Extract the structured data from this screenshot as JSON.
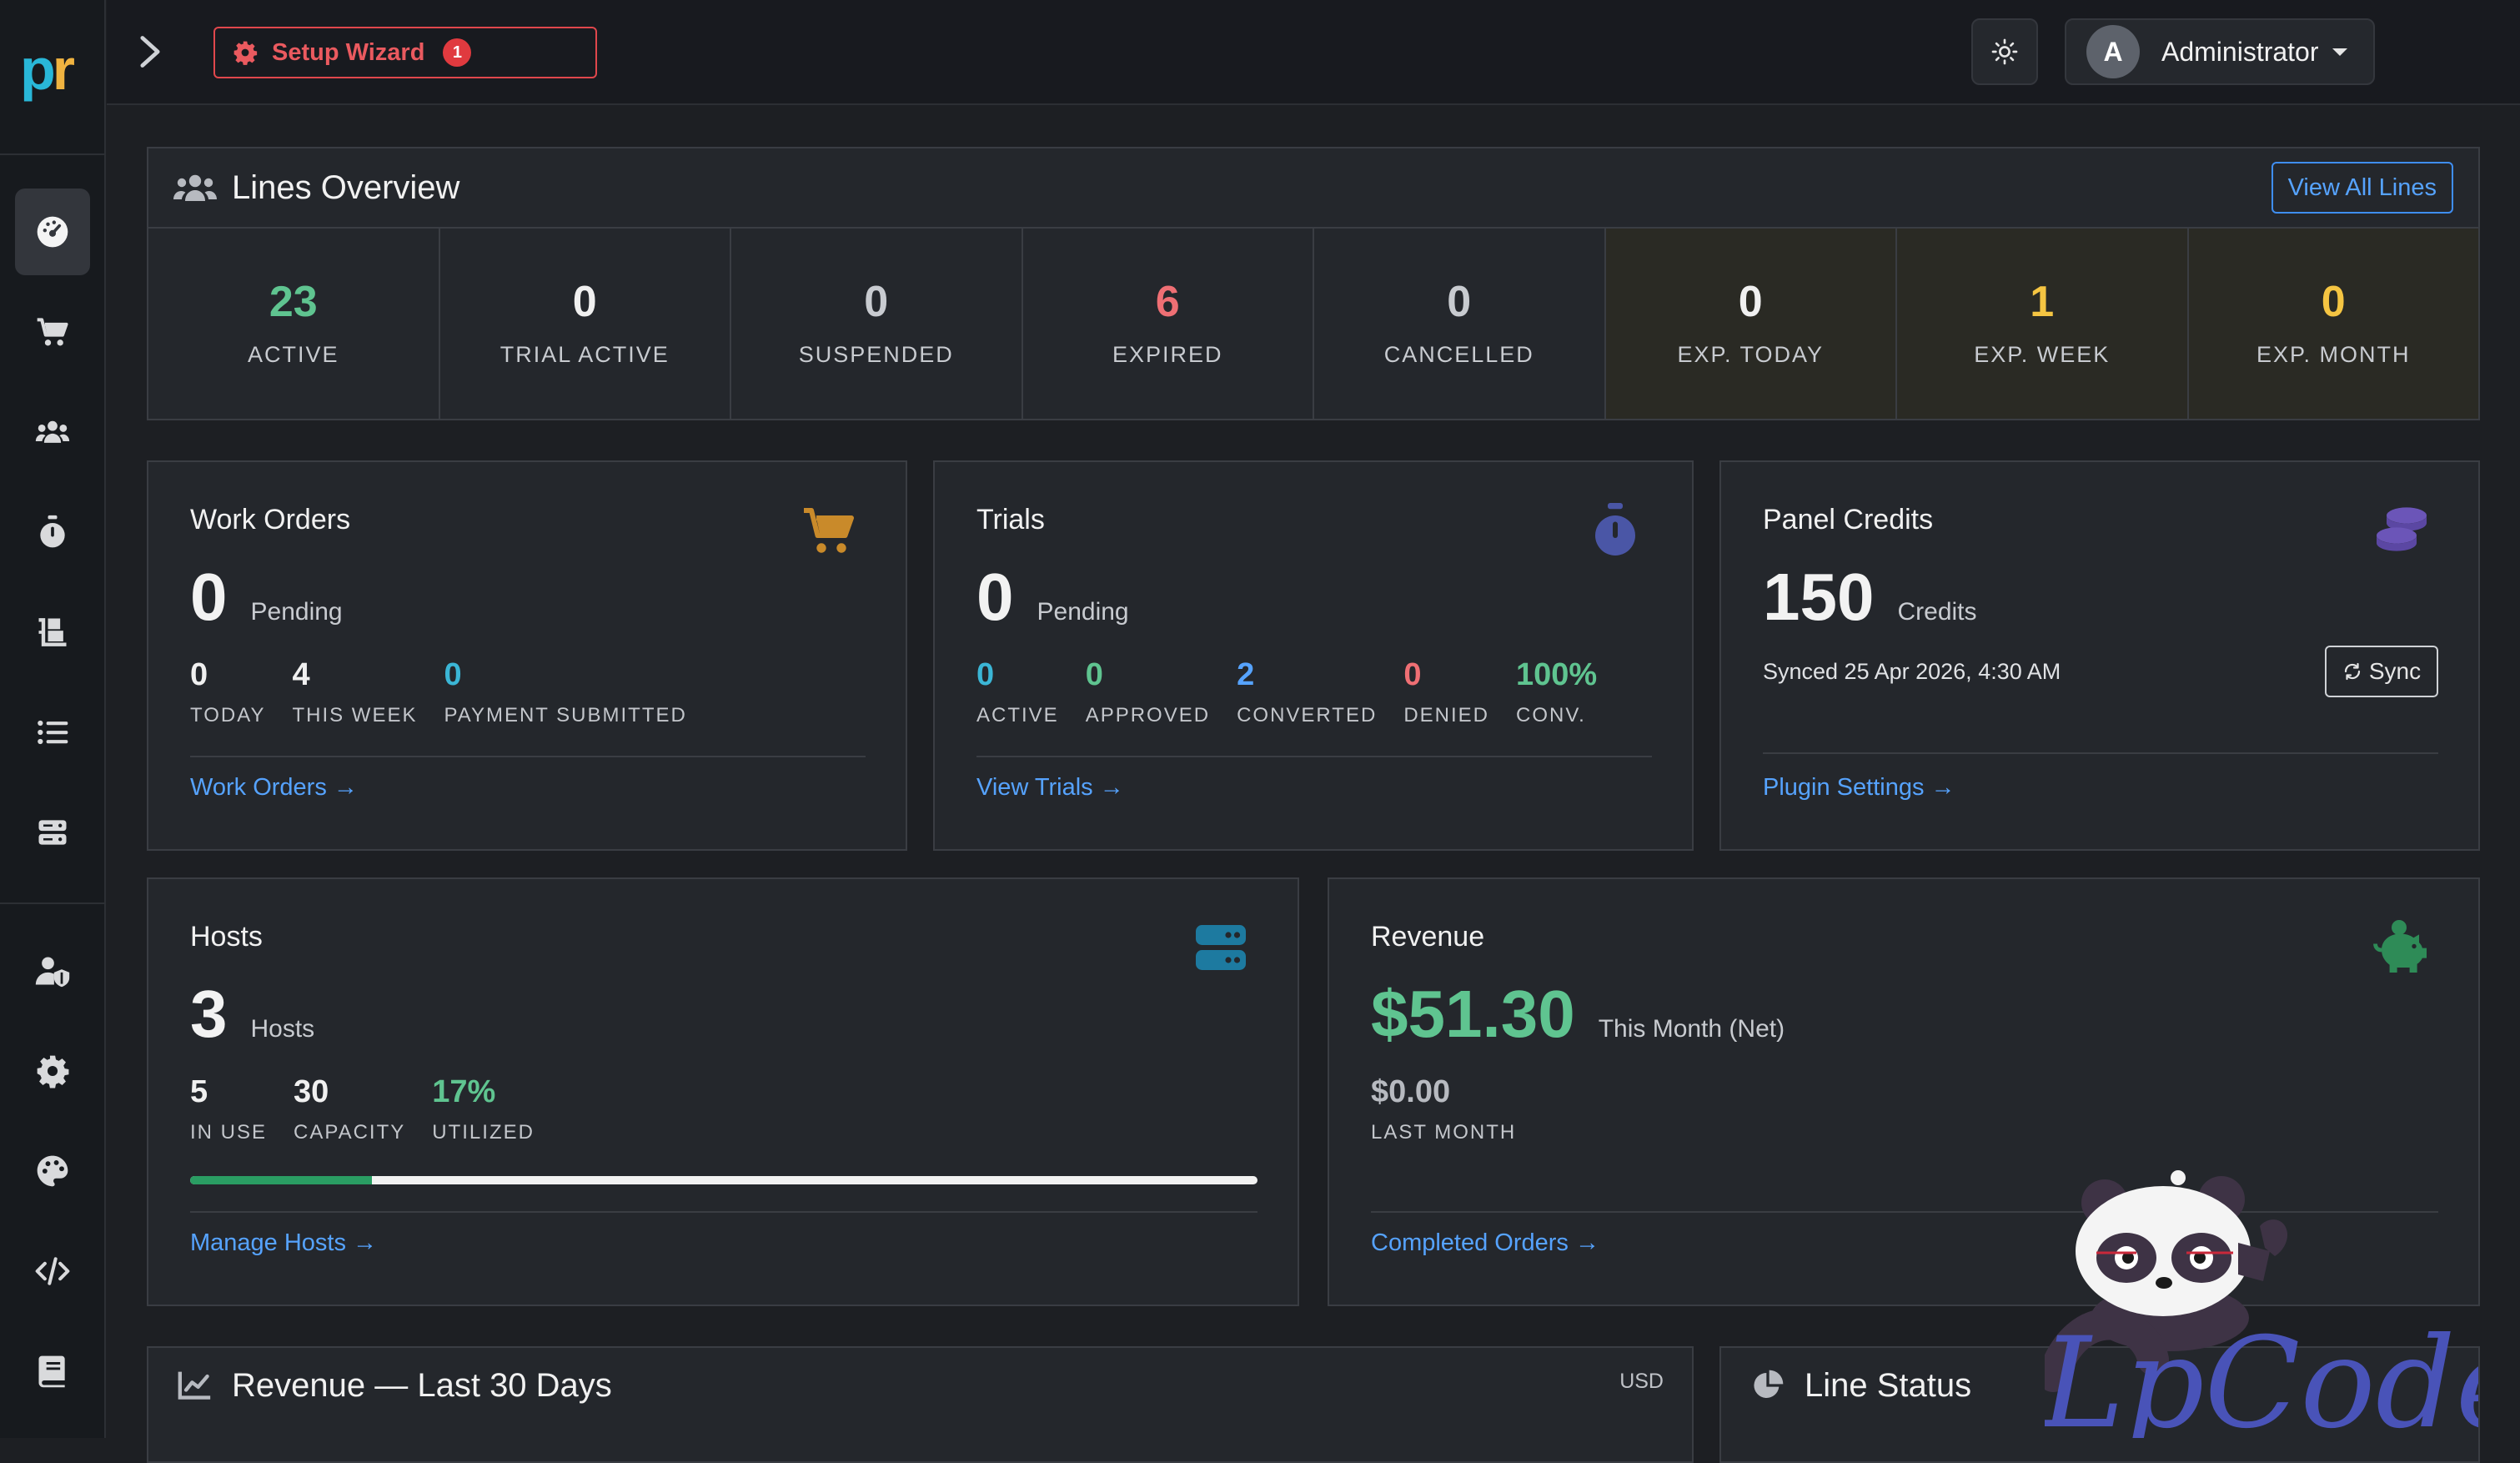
{
  "app": {
    "logo_left": "p",
    "logo_right": "r"
  },
  "sidebar": {
    "items": [
      {
        "icon": "dashboard-icon",
        "active": true
      },
      {
        "icon": "cart-icon"
      },
      {
        "icon": "users-icon"
      },
      {
        "icon": "stopwatch-icon"
      },
      {
        "icon": "dolly-icon"
      },
      {
        "icon": "list-icon"
      },
      {
        "icon": "server-icon"
      },
      {
        "icon": "user-shield-icon"
      },
      {
        "icon": "gear-icon"
      },
      {
        "icon": "palette-icon"
      },
      {
        "icon": "code-icon"
      },
      {
        "icon": "book-icon"
      }
    ]
  },
  "header": {
    "wizard_label": "Setup Wizard",
    "wizard_count": "1",
    "user_initial": "A",
    "user_name": "Administrator"
  },
  "lines_overview": {
    "title": "Lines Overview",
    "view_all": "View All Lines",
    "stats": [
      {
        "value": "23",
        "label": "ACTIVE",
        "color": "#5fc490"
      },
      {
        "value": "0",
        "label": "TRIAL ACTIVE",
        "color": "#f0f0f0"
      },
      {
        "value": "0",
        "label": "SUSPENDED",
        "color": "#c8cbd0"
      },
      {
        "value": "6",
        "label": "EXPIRED",
        "color": "#ef6f74"
      },
      {
        "value": "0",
        "label": "CANCELLED",
        "color": "#c8cbd0"
      },
      {
        "value": "0",
        "label": "EXP. TODAY",
        "color": "#f0f0f0"
      },
      {
        "value": "1",
        "label": "EXP. WEEK",
        "color": "#f5c542"
      },
      {
        "value": "0",
        "label": "EXP. MONTH",
        "color": "#f5c542"
      }
    ]
  },
  "work_orders": {
    "title": "Work Orders",
    "value": "0",
    "unit": "Pending",
    "subs": [
      {
        "value": "0",
        "label": "TODAY"
      },
      {
        "value": "4",
        "label": "THIS WEEK"
      },
      {
        "value": "0",
        "label": "PAYMENT SUBMITTED"
      }
    ],
    "link": "Work Orders →"
  },
  "trials": {
    "title": "Trials",
    "value": "0",
    "unit": "Pending",
    "subs": [
      {
        "value": "0",
        "label": "ACTIVE"
      },
      {
        "value": "0",
        "label": "APPROVED"
      },
      {
        "value": "2",
        "label": "CONVERTED"
      },
      {
        "value": "0",
        "label": "DENIED"
      },
      {
        "value": "100%",
        "label": "CONV."
      }
    ],
    "link": "View Trials →"
  },
  "panel_credits": {
    "title": "Panel Credits",
    "value": "150",
    "unit": "Credits",
    "synced": "Synced 25 Apr 2026, 4:30 AM",
    "sync_label": "Sync",
    "link": "Plugin Settings →"
  },
  "hosts": {
    "title": "Hosts",
    "value": "3",
    "unit": "Hosts",
    "subs": [
      {
        "value": "5",
        "label": "IN USE"
      },
      {
        "value": "30",
        "label": "CAPACITY"
      },
      {
        "value": "17%",
        "label": "UTILIZED"
      }
    ],
    "utilization": 0.17,
    "link": "Manage Hosts →"
  },
  "revenue": {
    "title": "Revenue",
    "value": "$51.30",
    "unit": "This Month (Net)",
    "last_value": "$0.00",
    "last_label": "LAST MONTH",
    "link": "Completed Orders →"
  },
  "revenue_30": {
    "title": "Revenue — Last 30 Days",
    "currency": "USD"
  },
  "line_status": {
    "title": "Line Status"
  },
  "watermark": {
    "text": "LpCodes"
  },
  "colors": {
    "accent": "#56a3ff",
    "green": "#2a9d63",
    "red": "#e0474c",
    "yellow": "#f5c542"
  }
}
